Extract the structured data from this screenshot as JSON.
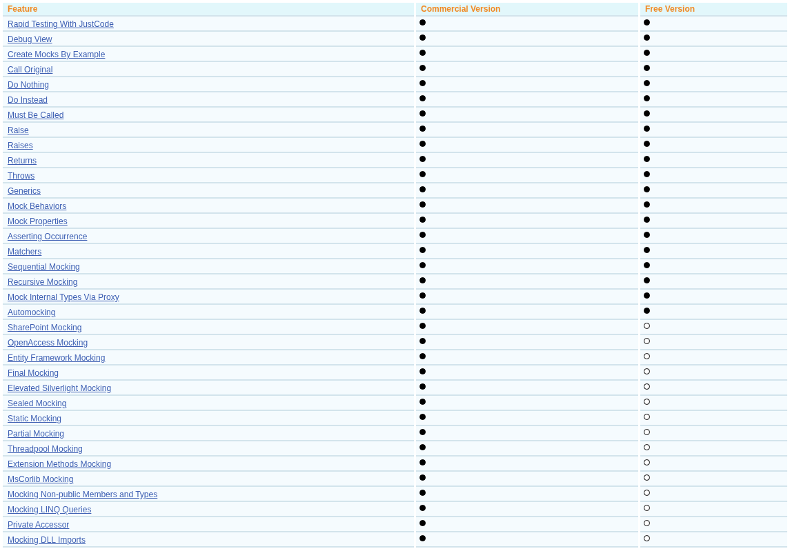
{
  "table": {
    "columns": [
      "Feature",
      "Commercial Version",
      "Free Version"
    ],
    "rows": [
      {
        "feature": "Rapid Testing With JustCode",
        "commercial": true,
        "free": true
      },
      {
        "feature": "Debug View",
        "commercial": true,
        "free": true
      },
      {
        "feature": "Create Mocks By Example",
        "commercial": true,
        "free": true
      },
      {
        "feature": "Call Original",
        "commercial": true,
        "free": true
      },
      {
        "feature": "Do Nothing",
        "commercial": true,
        "free": true
      },
      {
        "feature": "Do Instead",
        "commercial": true,
        "free": true
      },
      {
        "feature": "Must Be Called",
        "commercial": true,
        "free": true
      },
      {
        "feature": "Raise",
        "commercial": true,
        "free": true
      },
      {
        "feature": "Raises",
        "commercial": true,
        "free": true
      },
      {
        "feature": "Returns",
        "commercial": true,
        "free": true
      },
      {
        "feature": "Throws",
        "commercial": true,
        "free": true
      },
      {
        "feature": "Generics",
        "commercial": true,
        "free": true
      },
      {
        "feature": "Mock Behaviors",
        "commercial": true,
        "free": true
      },
      {
        "feature": "Mock Properties",
        "commercial": true,
        "free": true
      },
      {
        "feature": "Asserting Occurrence",
        "commercial": true,
        "free": true
      },
      {
        "feature": "Matchers",
        "commercial": true,
        "free": true
      },
      {
        "feature": "Sequential Mocking",
        "commercial": true,
        "free": true
      },
      {
        "feature": "Recursive Mocking",
        "commercial": true,
        "free": true
      },
      {
        "feature": "Mock Internal Types Via Proxy",
        "commercial": true,
        "free": true
      },
      {
        "feature": "Automocking",
        "commercial": true,
        "free": true
      },
      {
        "feature": "SharePoint Mocking",
        "commercial": true,
        "free": false
      },
      {
        "feature": "OpenAccess Mocking",
        "commercial": true,
        "free": false
      },
      {
        "feature": "Entity Framework Mocking",
        "commercial": true,
        "free": false
      },
      {
        "feature": "Final Mocking",
        "commercial": true,
        "free": false
      },
      {
        "feature": "Elevated Silverlight Mocking",
        "commercial": true,
        "free": false
      },
      {
        "feature": "Sealed Mocking",
        "commercial": true,
        "free": false
      },
      {
        "feature": "Static Mocking",
        "commercial": true,
        "free": false
      },
      {
        "feature": "Partial Mocking",
        "commercial": true,
        "free": false
      },
      {
        "feature": "Threadpool Mocking",
        "commercial": true,
        "free": false
      },
      {
        "feature": "Extension Methods Mocking",
        "commercial": true,
        "free": false
      },
      {
        "feature": "MsCorlib Mocking",
        "commercial": true,
        "free": false
      },
      {
        "feature": "Mocking Non-public Members and Types",
        "commercial": true,
        "free": false
      },
      {
        "feature": "Mocking LINQ Queries",
        "commercial": true,
        "free": false
      },
      {
        "feature": "Private Accessor",
        "commercial": true,
        "free": false
      },
      {
        "feature": "Mocking DLL Imports",
        "commercial": true,
        "free": false
      }
    ]
  }
}
